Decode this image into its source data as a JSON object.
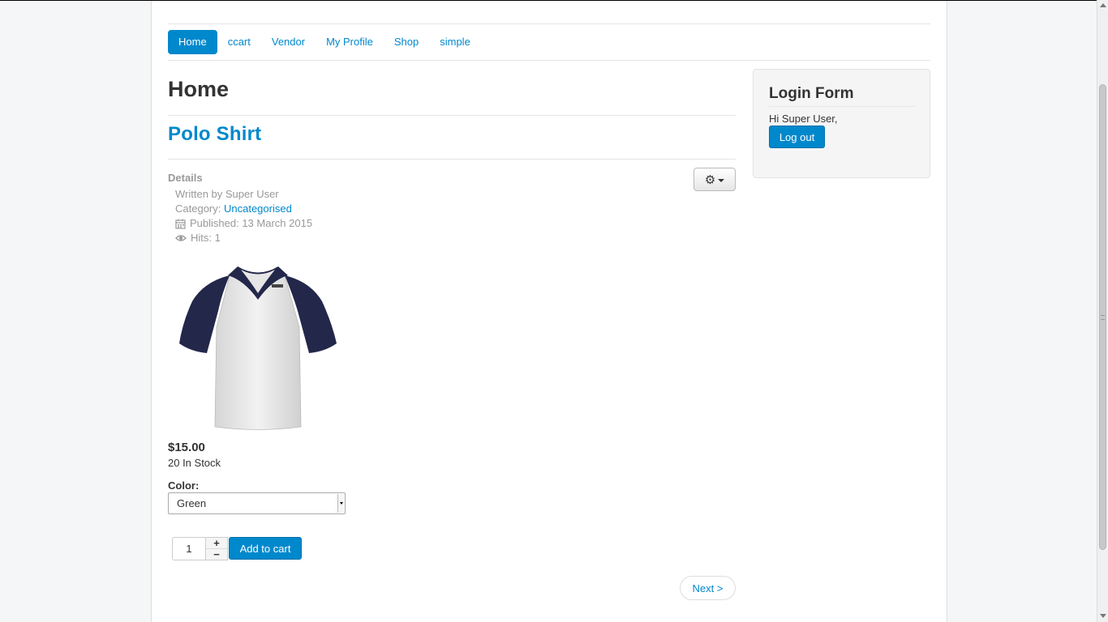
{
  "nav": {
    "items": [
      {
        "label": "Home",
        "active": true
      },
      {
        "label": "ccart"
      },
      {
        "label": "Vendor"
      },
      {
        "label": "My Profile"
      },
      {
        "label": "Shop"
      },
      {
        "label": "simple"
      }
    ]
  },
  "page": {
    "title": "Home"
  },
  "article": {
    "title": "Polo Shirt",
    "tools_icon": "gear-icon",
    "details": {
      "heading": "Details",
      "author": "Written by Super User",
      "category_prefix": "Category: ",
      "category": "Uncategorised",
      "published": "Published: 13 March 2015",
      "hits": "Hits: 1"
    }
  },
  "product": {
    "image": "white polo shirt with navy sleeves",
    "price": "$15.00",
    "stock": "20 In Stock",
    "color_label": "Color:",
    "color_value": "Green",
    "quantity": "1",
    "qty_plus": "+",
    "qty_minus": "−",
    "add_to_cart": "Add to cart"
  },
  "pagination": {
    "next": "Next >"
  },
  "sidebar": {
    "title": "Login Form",
    "greeting": "Hi Super User,",
    "logout": "Log out"
  },
  "colors": {
    "accent": "#0088cc",
    "background": "#f4f6f7"
  }
}
